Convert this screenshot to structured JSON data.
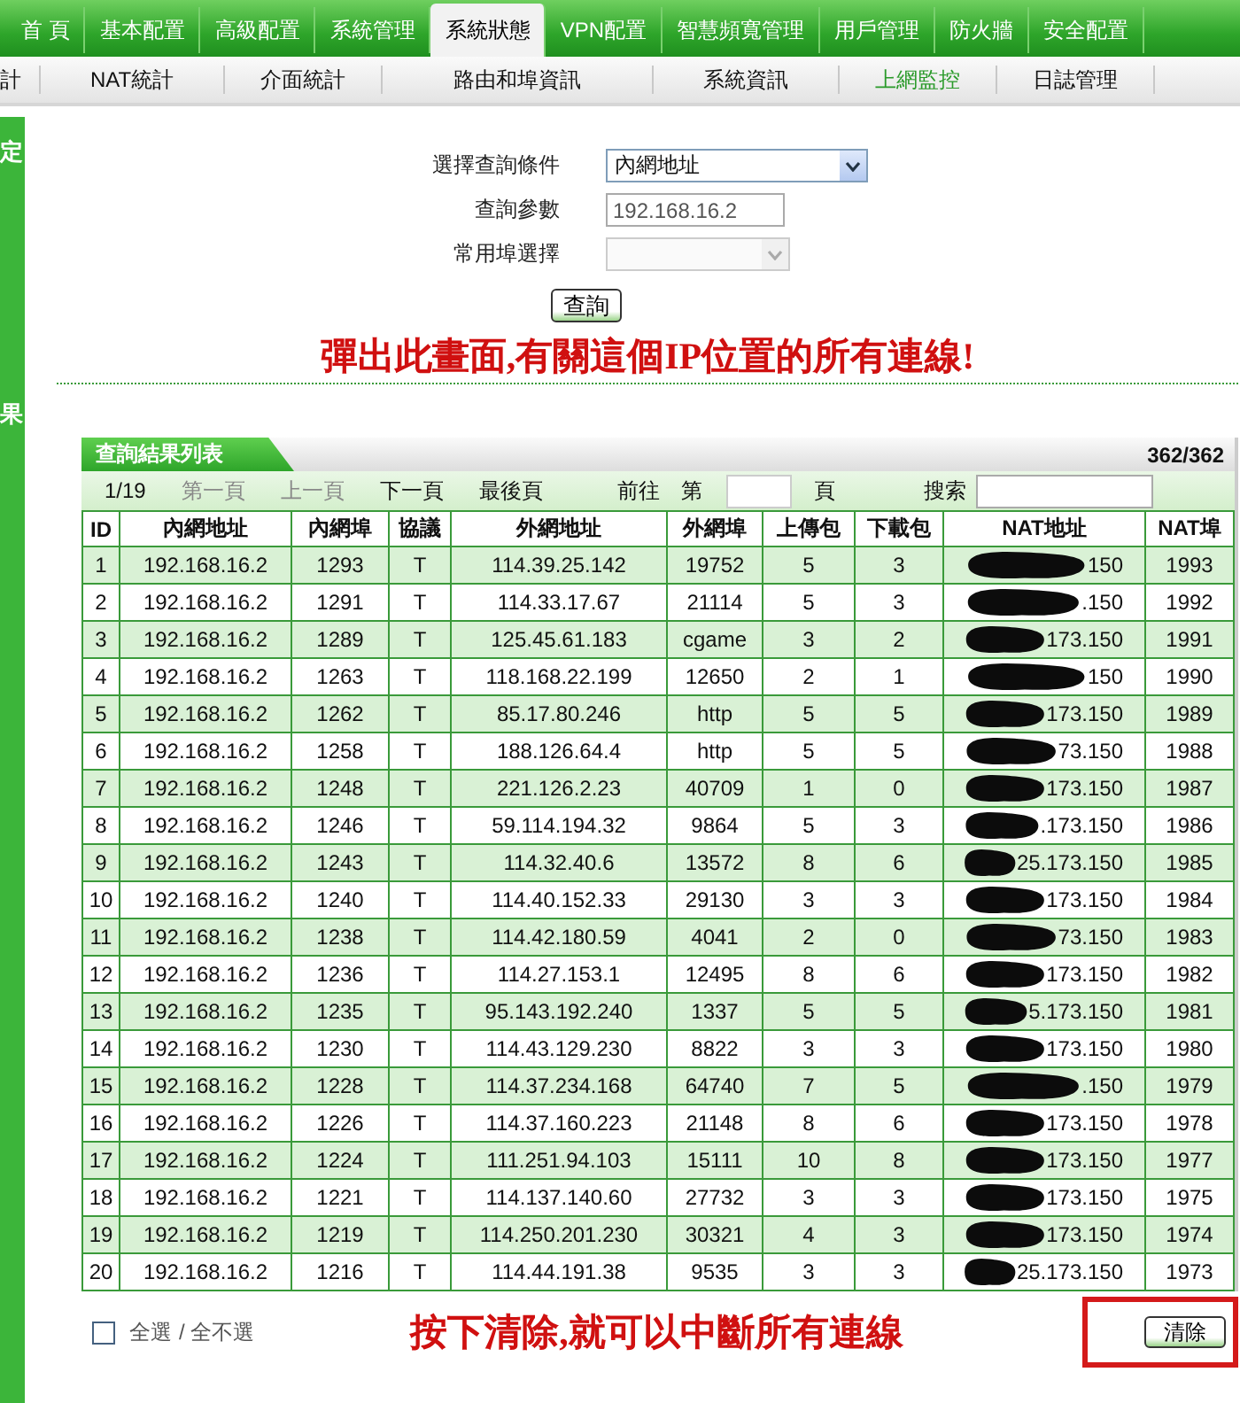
{
  "nav": [
    {
      "label": "首 頁",
      "selected": false
    },
    {
      "label": "基本配置",
      "selected": false
    },
    {
      "label": "高級配置",
      "selected": false
    },
    {
      "label": "系統管理",
      "selected": false
    },
    {
      "label": "系統狀態",
      "selected": true
    },
    {
      "label": "VPN配置",
      "selected": false
    },
    {
      "label": "智慧頻寬管理",
      "selected": false
    },
    {
      "label": "用戶管理",
      "selected": false
    },
    {
      "label": "防火牆",
      "selected": false
    },
    {
      "label": "安全配置",
      "selected": false
    }
  ],
  "subnav": [
    {
      "label": "計",
      "selected": false
    },
    {
      "label": "NAT統計",
      "selected": false
    },
    {
      "label": "介面統計",
      "selected": false
    },
    {
      "label": "路由和埠資訊",
      "selected": false
    },
    {
      "label": "系統資訊",
      "selected": false
    },
    {
      "label": "上網監控",
      "selected": true
    },
    {
      "label": "日誌管理",
      "selected": false
    }
  ],
  "sidebar": {
    "items": [
      "定",
      "果"
    ]
  },
  "form": {
    "fields": [
      {
        "kind": "select",
        "label": "選擇查詢條件",
        "value": "內網地址"
      },
      {
        "kind": "text",
        "label": "查詢參數",
        "value": "192.168.16.2"
      },
      {
        "kind": "select",
        "label": "常用埠選擇",
        "disabled": true
      }
    ],
    "button": "查詢"
  },
  "annotations": [
    "彈出此畫面,有關這個IP位置的所有連線!",
    "按下清除,就可以中斷所有連線"
  ],
  "results": {
    "title": "查詢結果列表",
    "count": "362/362",
    "pager": {
      "page": "1/19",
      "links": [
        {
          "label": "第一頁",
          "disabled": true
        },
        {
          "label": "上一頁",
          "disabled": true
        },
        {
          "label": "下一頁",
          "disabled": false
        },
        {
          "label": "最後頁",
          "disabled": false
        }
      ],
      "goto_label": "前往",
      "goto_prefix": "第",
      "goto_suffix": "頁",
      "search_label": "搜索"
    },
    "columns": [
      "ID",
      "內網地址",
      "內網埠",
      "協議",
      "外網地址",
      "外網埠",
      "上傳包",
      "下載包",
      "NAT地址",
      "NAT埠"
    ],
    "rows": [
      [
        "1",
        "192.168.16.2",
        "1293",
        "T",
        "114.39.25.142",
        "19752",
        "5",
        "3",
        "150",
        "1993"
      ],
      [
        "2",
        "192.168.16.2",
        "1291",
        "T",
        "114.33.17.67",
        "21114",
        "5",
        "3",
        ".150",
        "1992"
      ],
      [
        "3",
        "192.168.16.2",
        "1289",
        "T",
        "125.45.61.183",
        "cgame",
        "3",
        "2",
        "173.150",
        "1991"
      ],
      [
        "4",
        "192.168.16.2",
        "1263",
        "T",
        "118.168.22.199",
        "12650",
        "2",
        "1",
        "150",
        "1990"
      ],
      [
        "5",
        "192.168.16.2",
        "1262",
        "T",
        "85.17.80.246",
        "http",
        "5",
        "5",
        "173.150",
        "1989"
      ],
      [
        "6",
        "192.168.16.2",
        "1258",
        "T",
        "188.126.64.4",
        "http",
        "5",
        "5",
        "73.150",
        "1988"
      ],
      [
        "7",
        "192.168.16.2",
        "1248",
        "T",
        "221.126.2.23",
        "40709",
        "1",
        "0",
        "173.150",
        "1987"
      ],
      [
        "8",
        "192.168.16.2",
        "1246",
        "T",
        "59.114.194.32",
        "9864",
        "5",
        "3",
        ".173.150",
        "1986"
      ],
      [
        "9",
        "192.168.16.2",
        "1243",
        "T",
        "114.32.40.6",
        "13572",
        "8",
        "6",
        "25.173.150",
        "1985"
      ],
      [
        "10",
        "192.168.16.2",
        "1240",
        "T",
        "114.40.152.33",
        "29130",
        "3",
        "3",
        "173.150",
        "1984"
      ],
      [
        "11",
        "192.168.16.2",
        "1238",
        "T",
        "114.42.180.59",
        "4041",
        "2",
        "0",
        "73.150",
        "1983"
      ],
      [
        "12",
        "192.168.16.2",
        "1236",
        "T",
        "114.27.153.1",
        "12495",
        "8",
        "6",
        "173.150",
        "1982"
      ],
      [
        "13",
        "192.168.16.2",
        "1235",
        "T",
        "95.143.192.240",
        "1337",
        "5",
        "5",
        "5.173.150",
        "1981"
      ],
      [
        "14",
        "192.168.16.2",
        "1230",
        "T",
        "114.43.129.230",
        "8822",
        "3",
        "3",
        "173.150",
        "1980"
      ],
      [
        "15",
        "192.168.16.2",
        "1228",
        "T",
        "114.37.234.168",
        "64740",
        "7",
        "5",
        ".150",
        "1979"
      ],
      [
        "16",
        "192.168.16.2",
        "1226",
        "T",
        "114.37.160.223",
        "21148",
        "8",
        "6",
        "173.150",
        "1978"
      ],
      [
        "17",
        "192.168.16.2",
        "1224",
        "T",
        "111.251.94.103",
        "15111",
        "10",
        "8",
        "173.150",
        "1977"
      ],
      [
        "18",
        "192.168.16.2",
        "1221",
        "T",
        "114.137.140.60",
        "27732",
        "3",
        "3",
        "173.150",
        "1975"
      ],
      [
        "19",
        "192.168.16.2",
        "1219",
        "T",
        "114.250.201.230",
        "30321",
        "4",
        "3",
        "173.150",
        "1974"
      ],
      [
        "20",
        "192.168.16.2",
        "1216",
        "T",
        "114.44.191.38",
        "9535",
        "3",
        "3",
        "25.173.150",
        "1973"
      ]
    ]
  },
  "footer": {
    "select_all": {
      "label": "全選",
      "checked": false
    },
    "select_none": "/ 全不選",
    "clear_button": "清除"
  }
}
